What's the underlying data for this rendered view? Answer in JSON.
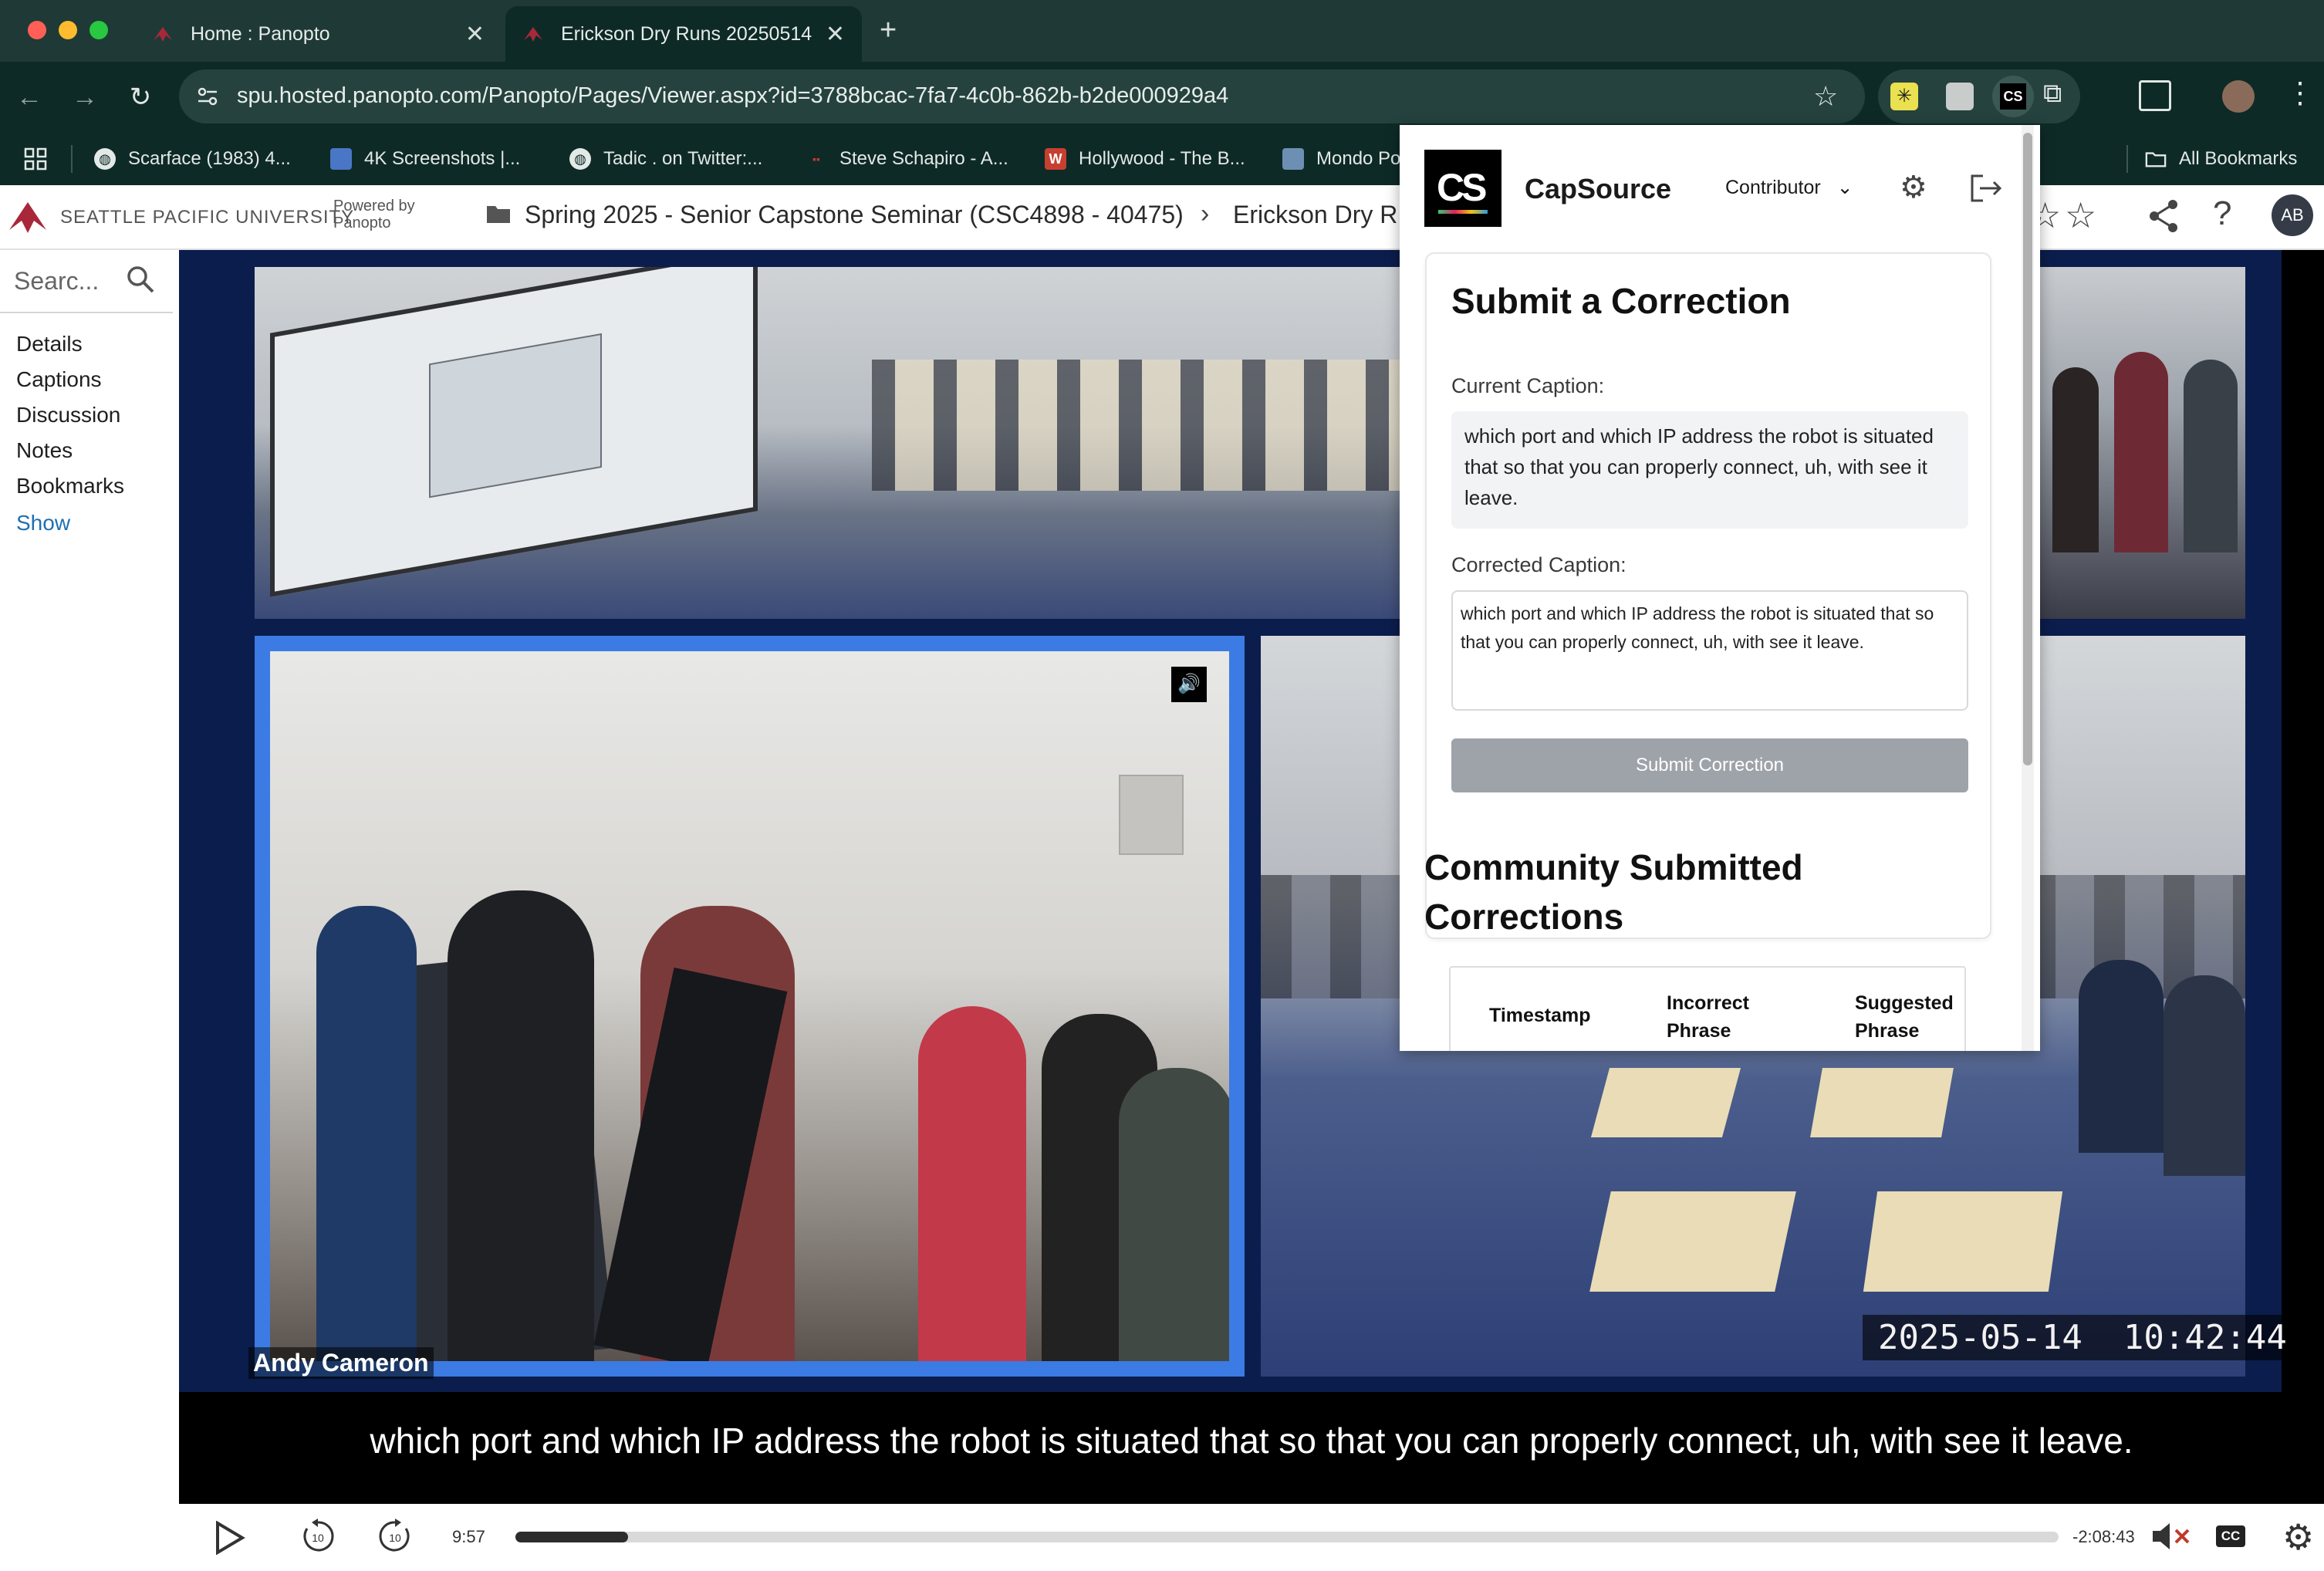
{
  "browser": {
    "tabs": [
      {
        "title": "Home : Panopto",
        "active": false
      },
      {
        "title": "Erickson Dry Runs 20250514",
        "active": true
      }
    ],
    "url": "spu.hosted.panopto.com/Panopto/Pages/Viewer.aspx?id=3788bcac-7fa7-4c0b-862b-b2de000929a4",
    "bookmarks": [
      "Scarface (1983) 4...",
      "4K Screenshots |...",
      "Tadic . on Twitter:...",
      "Steve Schapiro - A...",
      "Hollywood - The B...",
      "Mondo Po"
    ],
    "all_bookmarks": "All Bookmarks",
    "accent": "#0e2a27"
  },
  "panopto": {
    "university": "SEATTLE PACIFIC UNIVERSITY",
    "powered_by": "Powered by",
    "panopto": "Panopto",
    "breadcrumb_folder": "Spring 2025 - Senior Capstone Seminar (CSC4898 - 40475)",
    "breadcrumb_session": "Erickson Dry R",
    "avatar": "AB",
    "search_placeholder": "Searc...",
    "sidebar": [
      "Details",
      "Captions",
      "Discussion",
      "Notes",
      "Bookmarks"
    ],
    "sidebar_show": "Show"
  },
  "video": {
    "speaker": "Andy Cameron",
    "timestamp": "2025-05-14  10:42:44",
    "caption": "which port and which IP address the robot is situated that so that you can properly connect, uh, with see it leave.",
    "elapsed": "9:57",
    "remaining": "-2:08:43",
    "progress": 0.073,
    "cc": "CC"
  },
  "capsource": {
    "brand": "CapSource",
    "logo_text": "CS",
    "role": "Contributor",
    "card_title": "Submit a Correction",
    "current_label": "Current Caption:",
    "current_caption": "which port and which IP address the robot is situated that so that you can properly connect, uh, with see it leave.",
    "corrected_label": "Corrected Caption:",
    "corrected_caption": "which port and which IP address the robot is situated that so that you can properly connect, uh, with see it leave.",
    "submit": "Submit Correction",
    "community_title_1": "Community Submitted",
    "community_title_2": "Corrections",
    "table_headers": [
      "Timestamp",
      "Incorrect Phrase",
      "Suggested Phrase"
    ]
  }
}
